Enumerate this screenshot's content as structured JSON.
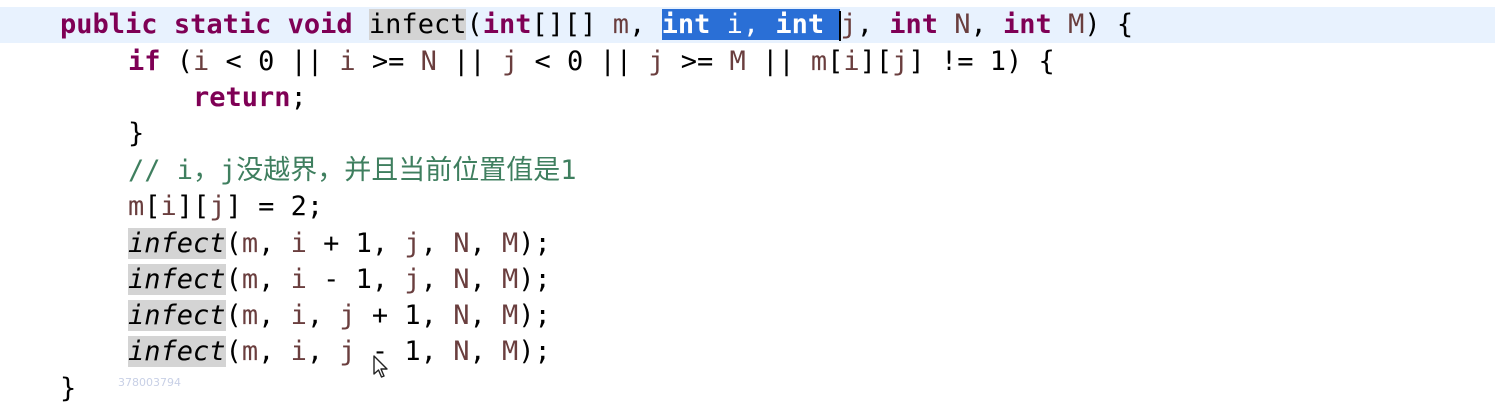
{
  "editor": {
    "lines": [
      {
        "indent": 60,
        "tokens": [
          {
            "t": "public",
            "c": "kw"
          },
          {
            "t": " ",
            "c": "plain"
          },
          {
            "t": "static",
            "c": "kw"
          },
          {
            "t": " ",
            "c": "plain"
          },
          {
            "t": "void",
            "c": "kw"
          },
          {
            "t": " ",
            "c": "plain"
          },
          {
            "t": "infect",
            "c": "mdecl"
          },
          {
            "t": "(",
            "c": "plain"
          },
          {
            "t": "int",
            "c": "kw"
          },
          {
            "t": "[][] ",
            "c": "plain"
          },
          {
            "t": "m",
            "c": "var"
          },
          {
            "t": ", ",
            "c": "plain"
          },
          {
            "t": "int",
            "c": "sel"
          },
          {
            "t": " i, ",
            "c": "sel-plain"
          },
          {
            "t": "int",
            "c": "sel"
          },
          {
            "t": " ",
            "c": "sel-plain"
          },
          {
            "t": "|",
            "c": "caret"
          },
          {
            "t": "j",
            "c": "var"
          },
          {
            "t": ", ",
            "c": "plain"
          },
          {
            "t": "int",
            "c": "kw"
          },
          {
            "t": " ",
            "c": "plain"
          },
          {
            "t": "N",
            "c": "var"
          },
          {
            "t": ", ",
            "c": "plain"
          },
          {
            "t": "int",
            "c": "kw"
          },
          {
            "t": " ",
            "c": "plain"
          },
          {
            "t": "M",
            "c": "var"
          },
          {
            "t": ") {",
            "c": "plain"
          }
        ]
      },
      {
        "indent": 128,
        "tokens": [
          {
            "t": "if",
            "c": "kw"
          },
          {
            "t": " (",
            "c": "plain"
          },
          {
            "t": "i",
            "c": "var"
          },
          {
            "t": " < 0 || ",
            "c": "plain"
          },
          {
            "t": "i",
            "c": "var"
          },
          {
            "t": " >= ",
            "c": "plain"
          },
          {
            "t": "N",
            "c": "var"
          },
          {
            "t": " || ",
            "c": "plain"
          },
          {
            "t": "j",
            "c": "var"
          },
          {
            "t": " < 0 || ",
            "c": "plain"
          },
          {
            "t": "j",
            "c": "var"
          },
          {
            "t": " >= ",
            "c": "plain"
          },
          {
            "t": "M",
            "c": "var"
          },
          {
            "t": " || ",
            "c": "plain"
          },
          {
            "t": "m",
            "c": "var"
          },
          {
            "t": "[",
            "c": "plain"
          },
          {
            "t": "i",
            "c": "var"
          },
          {
            "t": "][",
            "c": "plain"
          },
          {
            "t": "j",
            "c": "var"
          },
          {
            "t": "] != 1) {",
            "c": "plain"
          }
        ]
      },
      {
        "indent": 193,
        "tokens": [
          {
            "t": "return",
            "c": "kw"
          },
          {
            "t": ";",
            "c": "plain"
          }
        ]
      },
      {
        "indent": 128,
        "tokens": [
          {
            "t": "}",
            "c": "plain"
          }
        ]
      },
      {
        "indent": 128,
        "tokens": [
          {
            "t": "// i，j没越界，并且当前位置值是1",
            "c": "cm"
          }
        ]
      },
      {
        "indent": 128,
        "tokens": [
          {
            "t": "m",
            "c": "var"
          },
          {
            "t": "[",
            "c": "plain"
          },
          {
            "t": "i",
            "c": "var"
          },
          {
            "t": "][",
            "c": "plain"
          },
          {
            "t": "j",
            "c": "var"
          },
          {
            "t": "] = 2;",
            "c": "plain"
          }
        ]
      },
      {
        "indent": 128,
        "tokens": [
          {
            "t": "infect",
            "c": "call"
          },
          {
            "t": "(",
            "c": "plain"
          },
          {
            "t": "m",
            "c": "var"
          },
          {
            "t": ", ",
            "c": "plain"
          },
          {
            "t": "i",
            "c": "var"
          },
          {
            "t": " + 1, ",
            "c": "plain"
          },
          {
            "t": "j",
            "c": "var"
          },
          {
            "t": ", ",
            "c": "plain"
          },
          {
            "t": "N",
            "c": "var"
          },
          {
            "t": ", ",
            "c": "plain"
          },
          {
            "t": "M",
            "c": "var"
          },
          {
            "t": ");",
            "c": "plain"
          }
        ]
      },
      {
        "indent": 128,
        "tokens": [
          {
            "t": "infect",
            "c": "call"
          },
          {
            "t": "(",
            "c": "plain"
          },
          {
            "t": "m",
            "c": "var"
          },
          {
            "t": ", ",
            "c": "plain"
          },
          {
            "t": "i",
            "c": "var"
          },
          {
            "t": " - 1, ",
            "c": "plain"
          },
          {
            "t": "j",
            "c": "var"
          },
          {
            "t": ", ",
            "c": "plain"
          },
          {
            "t": "N",
            "c": "var"
          },
          {
            "t": ", ",
            "c": "plain"
          },
          {
            "t": "M",
            "c": "var"
          },
          {
            "t": ");",
            "c": "plain"
          }
        ]
      },
      {
        "indent": 128,
        "tokens": [
          {
            "t": "infect",
            "c": "call"
          },
          {
            "t": "(",
            "c": "plain"
          },
          {
            "t": "m",
            "c": "var"
          },
          {
            "t": ", ",
            "c": "plain"
          },
          {
            "t": "i",
            "c": "var"
          },
          {
            "t": ", ",
            "c": "plain"
          },
          {
            "t": "j",
            "c": "var"
          },
          {
            "t": " + 1, ",
            "c": "plain"
          },
          {
            "t": "N",
            "c": "var"
          },
          {
            "t": ", ",
            "c": "plain"
          },
          {
            "t": "M",
            "c": "var"
          },
          {
            "t": ");",
            "c": "plain"
          }
        ]
      },
      {
        "indent": 128,
        "tokens": [
          {
            "t": "infect",
            "c": "call"
          },
          {
            "t": "(",
            "c": "plain"
          },
          {
            "t": "m",
            "c": "var"
          },
          {
            "t": ", ",
            "c": "plain"
          },
          {
            "t": "i",
            "c": "var"
          },
          {
            "t": ", ",
            "c": "plain"
          },
          {
            "t": "j",
            "c": "var"
          },
          {
            "t": " - 1, ",
            "c": "plain"
          },
          {
            "t": "N",
            "c": "var"
          },
          {
            "t": ", ",
            "c": "plain"
          },
          {
            "t": "M",
            "c": "var"
          },
          {
            "t": ");",
            "c": "plain"
          }
        ]
      },
      {
        "indent": 60,
        "tokens": [
          {
            "t": "}",
            "c": "plain"
          }
        ]
      }
    ]
  },
  "watermark": "378003794",
  "icons": {
    "pointer": "mouse-pointer-icon"
  },
  "colors": {
    "keyword": "#7f0055",
    "variable": "#6a3e3e",
    "comment": "#3f7f5f",
    "selection": "#2a6fd6",
    "current_line": "#e8f2fe",
    "occurrence": "#d4d4d4"
  }
}
